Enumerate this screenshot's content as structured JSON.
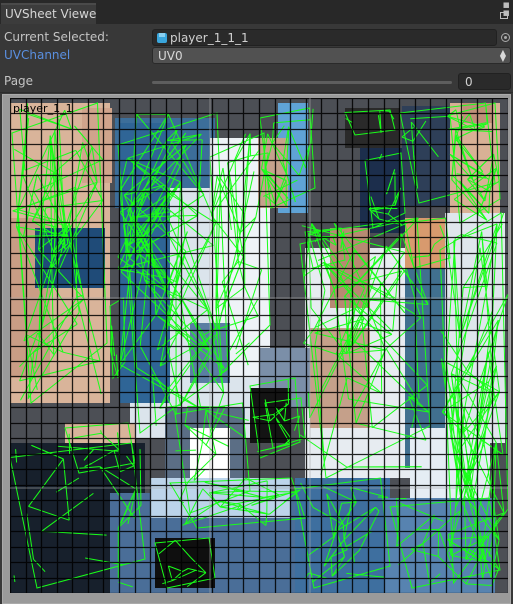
{
  "window": {
    "tab_title": "UVSheet Viewe",
    "menu_icon": "kebab-menu-icon",
    "maximize_icon": "maximize-icon"
  },
  "fields": {
    "current_selected_label": "Current Selected:",
    "current_selected_value": "player_1_1_1",
    "current_selected_icon": "mesh-cube-icon",
    "uvchannel_label": "UVChannel",
    "uvchannel_value": "UV0",
    "page_label": "Page",
    "page_value": "0"
  },
  "viewer": {
    "mesh_label": "player_1_1",
    "grid_color": "#000000",
    "wire_color": "#19ff19"
  }
}
